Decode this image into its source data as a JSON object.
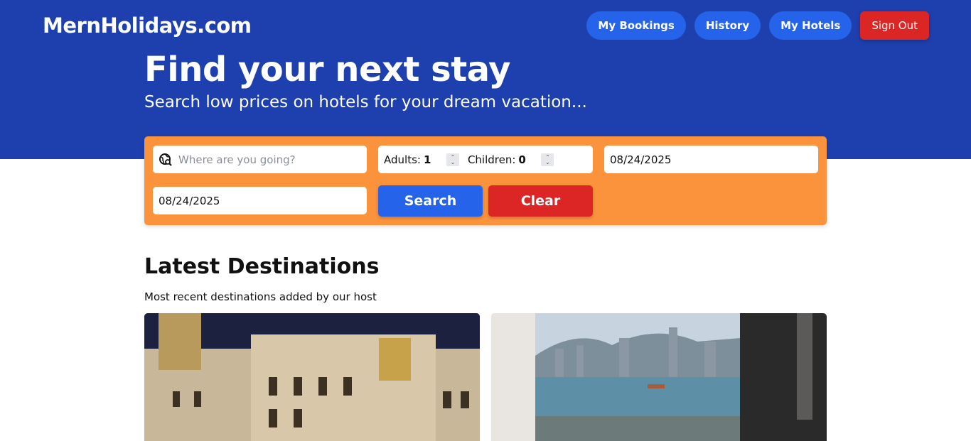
{
  "header": {
    "logo": "MernHolidays.com",
    "nav": {
      "bookings": "My Bookings",
      "history": "History",
      "hotels": "My Hotels",
      "signout": "Sign Out"
    },
    "title": "Find your next stay",
    "subtitle": "Search low prices on hotels for your dream vacation..."
  },
  "search": {
    "destination_placeholder": "Where are you going?",
    "adults_label": "Adults:",
    "adults_value": "1",
    "children_label": "Children:",
    "children_value": "0",
    "checkin": "08/24/2025",
    "checkout": "08/24/2025",
    "search_label": "Search",
    "clear_label": "Clear"
  },
  "latest": {
    "title": "Latest Destinations",
    "subtitle": "Most recent destinations added by our host"
  },
  "colors": {
    "hero": "#1e40af",
    "search_panel": "#fb923c",
    "primary": "#2563eb",
    "danger": "#dc2626"
  }
}
